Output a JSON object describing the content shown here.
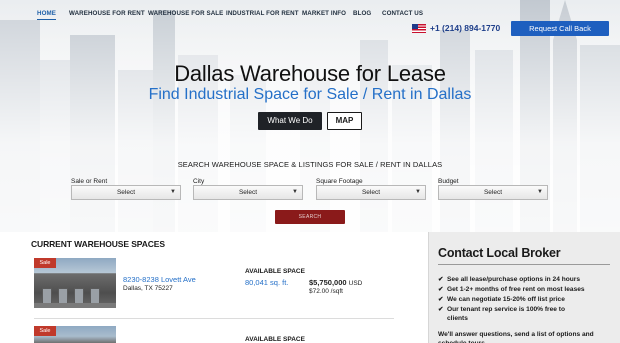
{
  "nav": {
    "items": [
      "HOME",
      "WAREHOUSE FOR RENT",
      "WAREHOUSE FOR SALE",
      "INDUSTRIAL FOR RENT",
      "MARKET INFO",
      "BLOG",
      "CONTACT US"
    ],
    "active": "HOME",
    "phone": "+1 (214) 894-1770",
    "flag_icon": "us-flag-icon",
    "callback_label": "Request Call Back"
  },
  "hero": {
    "title": "Dallas Warehouse for Lease",
    "subtitle": "Find Industrial Space for Sale / Rent in Dallas",
    "what_we_do_label": "What We Do",
    "map_label": "MAP"
  },
  "search": {
    "heading": "SEARCH WAREHOUSE SPACE & LISTINGS FOR SALE / RENT IN DALLAS",
    "filters": [
      {
        "label": "Sale or Rent",
        "value": "Select"
      },
      {
        "label": "City",
        "value": "Select"
      },
      {
        "label": "Square Footage",
        "value": "Select"
      },
      {
        "label": "Budget",
        "value": "Select"
      }
    ],
    "button_label": "SEARCH"
  },
  "listings": {
    "heading": "CURRENT WAREHOUSE SPACES",
    "items": [
      {
        "badge": "Sale",
        "address": "8230-8238 Lovett Ave",
        "city": "Dallas, TX 75227",
        "available_label": "AVAILABLE SPACE",
        "size": "80,041 sq. ft.",
        "price": "$5,750,000",
        "currency": "USD",
        "per_sqft": "$72.00 /sqft"
      },
      {
        "badge": "Sale",
        "available_label": "AVAILABLE SPACE"
      }
    ]
  },
  "broker": {
    "title": "Contact Local Broker",
    "items": [
      "See all lease/purchase options in 24 hours",
      "Get 1-2+ months of free rent on most leases",
      "We can negotiate 15-20% off list price",
      "Our tenant rep service is 100% free to"
    ],
    "item_continuation": "clients",
    "footer": "We'll answer questions, send a list of options and schedule tours"
  },
  "colors": {
    "accent_blue": "#1e5fbf",
    "link_blue": "#2570c8",
    "search_red": "#8a1a1a",
    "sale_red": "#c0392b"
  }
}
